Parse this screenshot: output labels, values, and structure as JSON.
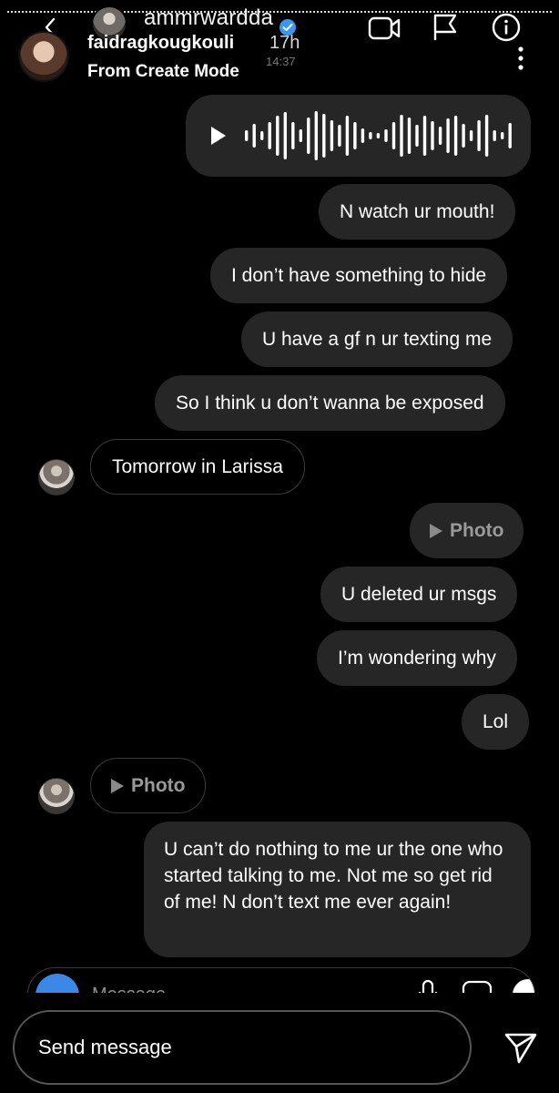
{
  "header": {
    "thread_name": "ammrwardda",
    "faint_time": "14:37"
  },
  "story": {
    "username": "faidragkougkouli",
    "time": "17h",
    "subtitle": "From Create Mode"
  },
  "messages": [
    {
      "text": "N watch ur mouth!",
      "side": "sent"
    },
    {
      "text": "I don’t have something to hide",
      "side": "sent"
    },
    {
      "text": "U have a gf n ur texting me",
      "side": "sent"
    },
    {
      "text": "So I think u don’t wanna be exposed",
      "side": "sent"
    },
    {
      "text": "Tomorrow in Larissa",
      "side": "received"
    },
    {
      "text": "Photo",
      "side": "sent",
      "kind": "photo"
    },
    {
      "text": "U deleted ur msgs",
      "side": "sent"
    },
    {
      "text": "I’m wondering why",
      "side": "sent"
    },
    {
      "text": "Lol",
      "side": "sent"
    },
    {
      "text": "Photo",
      "side": "received",
      "kind": "photo"
    },
    {
      "text": "U can’t do nothing to me ur the one who started talking to me. Not me so get rid of me! N don’t text me ever again!",
      "side": "sent"
    }
  ],
  "composer": {
    "placeholder": "Message"
  },
  "reply": {
    "placeholder": "Send message"
  },
  "colors": {
    "background": "#000000",
    "bubble": "#262626",
    "verified": "#3897f0",
    "camera": "#3b88e6"
  },
  "icons": [
    "back-icon",
    "verified-icon",
    "video-call-icon",
    "flag-icon",
    "info-icon",
    "more-icon",
    "play-icon",
    "camera-icon",
    "mic-icon",
    "gallery-icon",
    "plus-icon",
    "send-icon"
  ]
}
